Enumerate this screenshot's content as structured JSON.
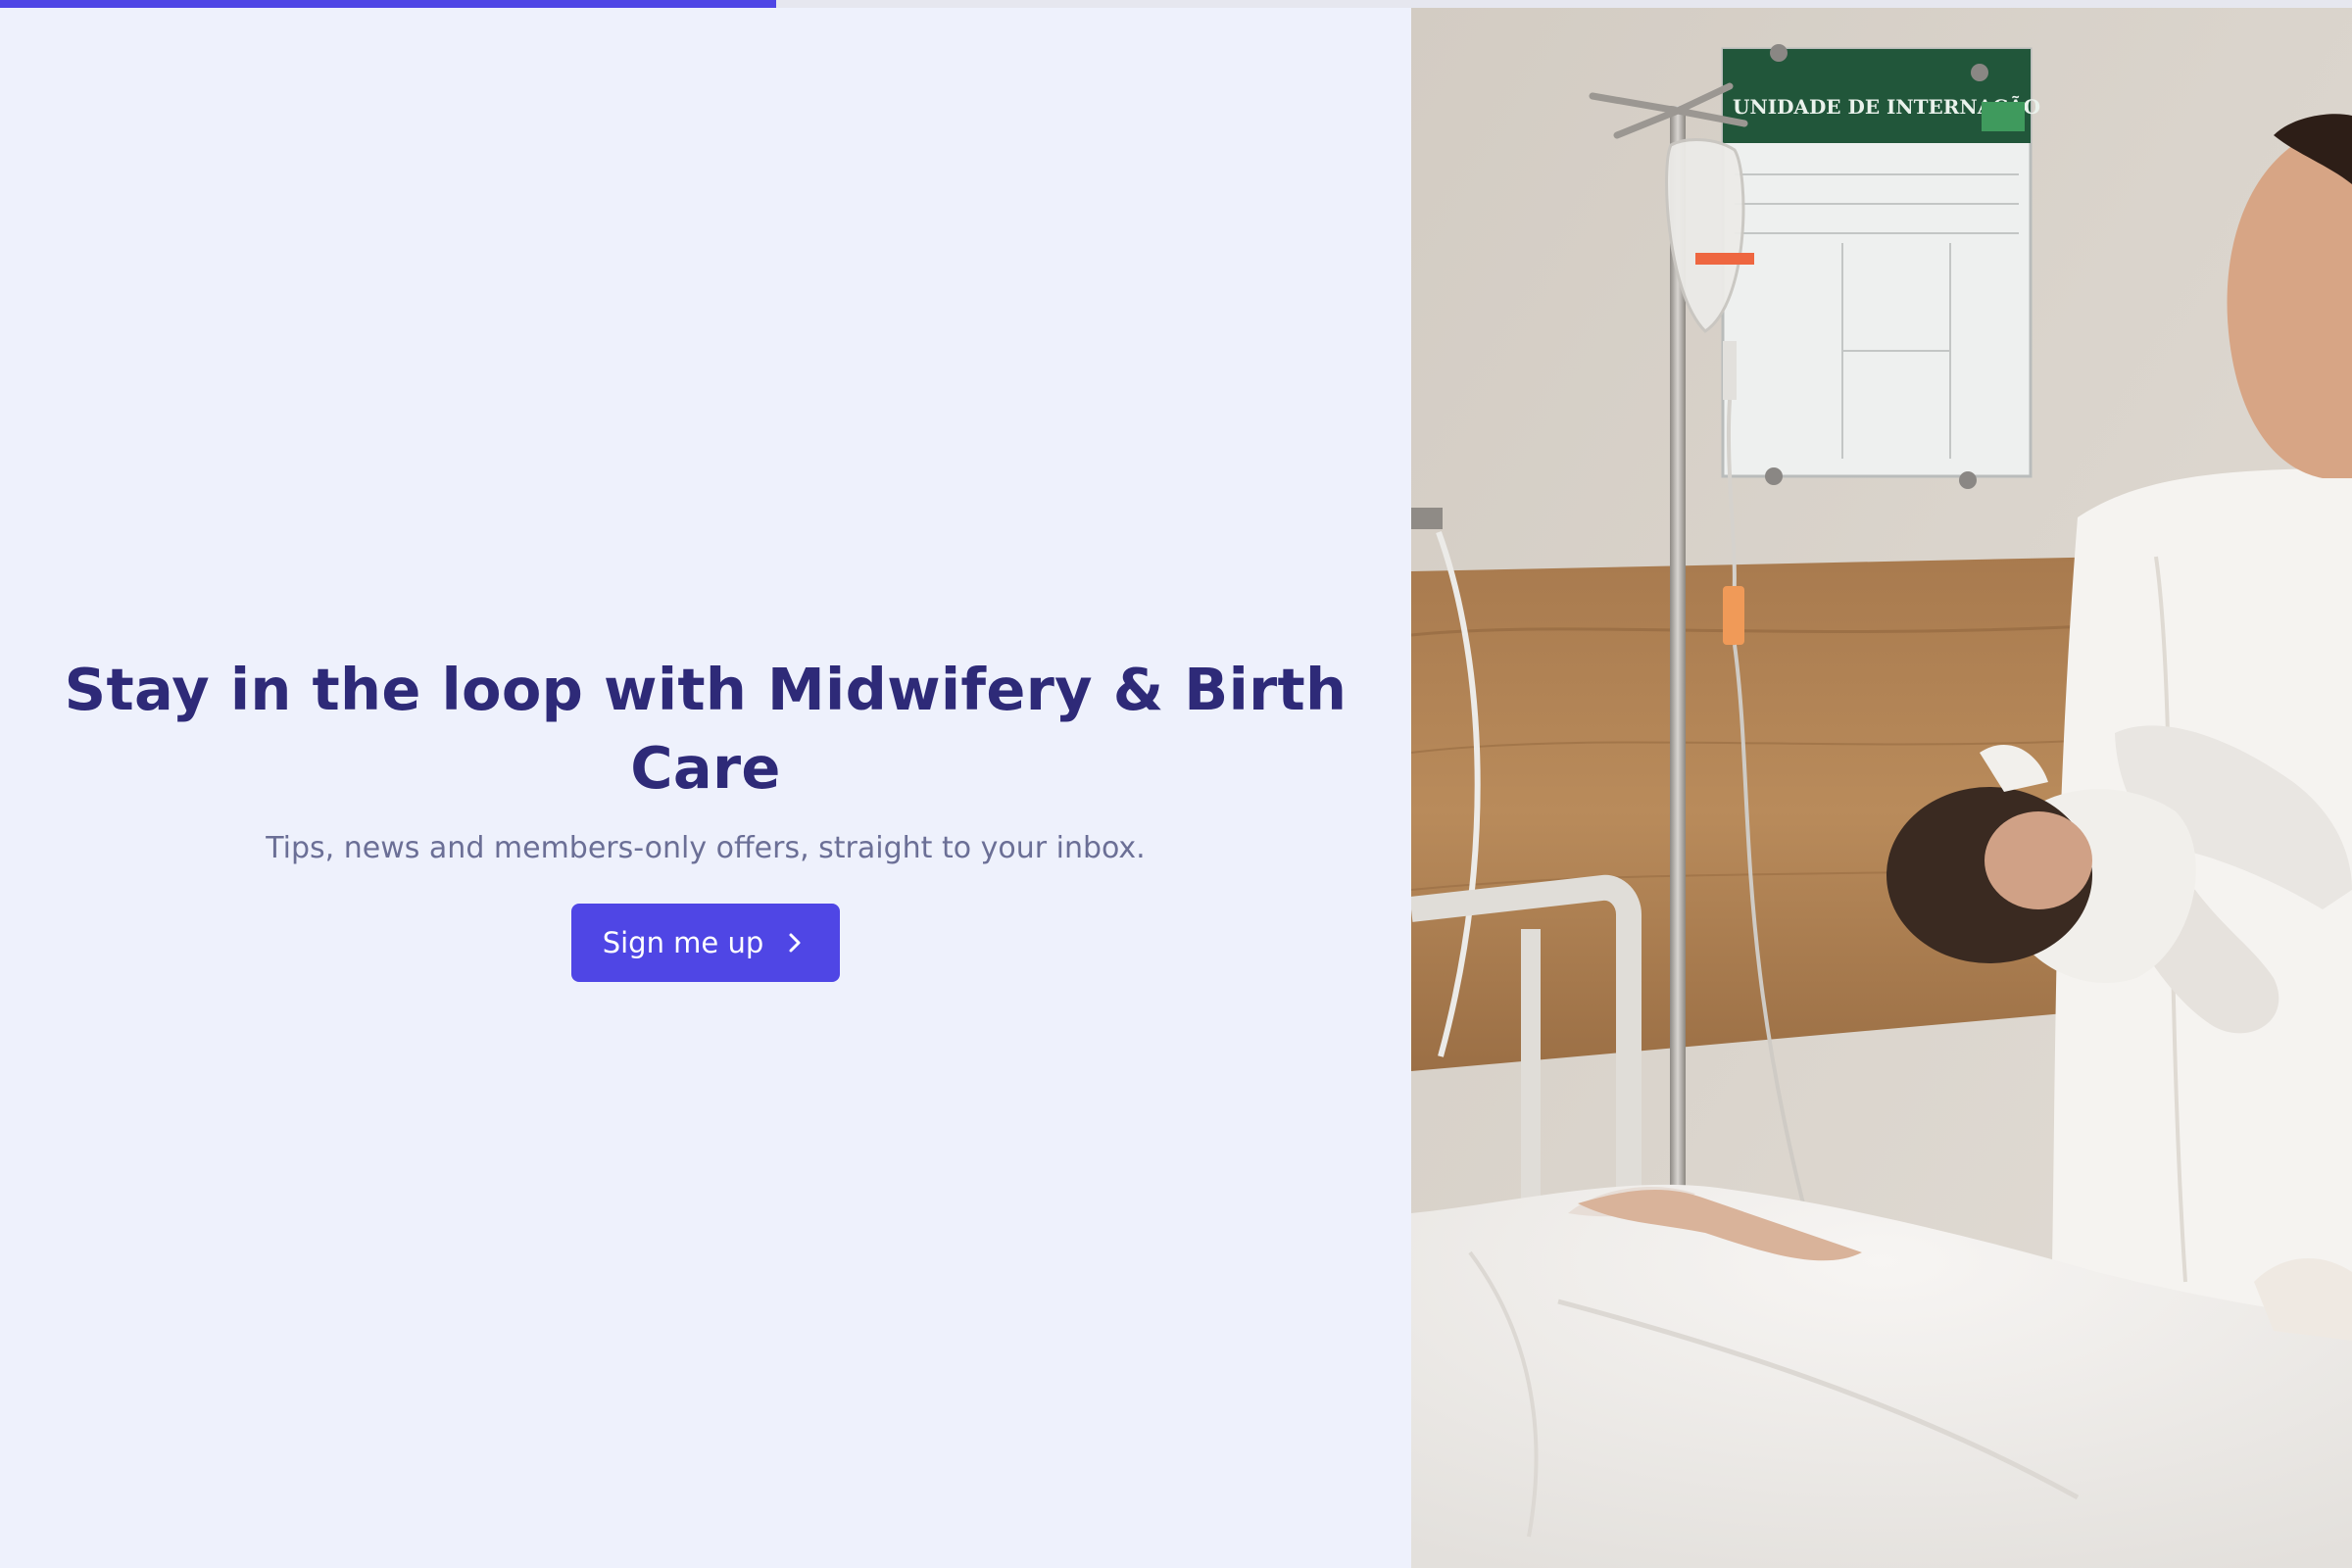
{
  "progress": {
    "value": 0.33,
    "color": "#4f46e5"
  },
  "signup": {
    "headline": "Stay in the loop with Midwifery & Birth Care",
    "subheadline": "Tips, news and members-only offers, straight to your inbox.",
    "cta_label": "Sign me up",
    "cta_icon": "chevron-right-icon"
  },
  "photo": {
    "sign_text": "UNIDADE DE INTERNAÇÃO"
  },
  "colors": {
    "accent": "#4f46e5",
    "headline": "#2e2a78",
    "subtext": "#6b6f96",
    "background": "#eef1fc"
  }
}
